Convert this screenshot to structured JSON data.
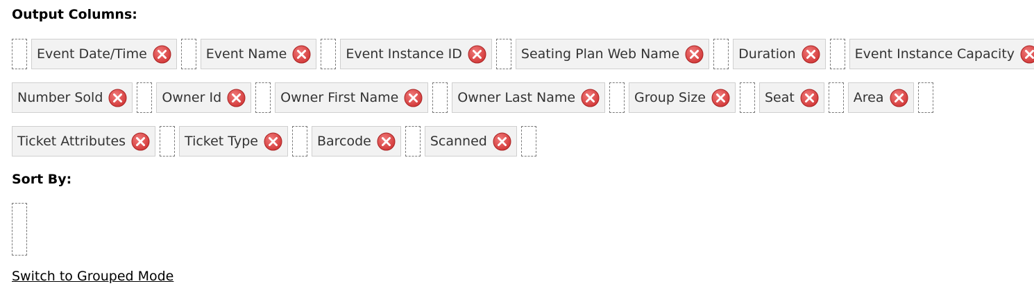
{
  "output_columns": {
    "heading": "Output Columns:",
    "rows": [
      [
        {
          "label": "Event Date/Time"
        },
        {
          "label": "Event Name"
        },
        {
          "label": "Event Instance ID"
        },
        {
          "label": "Seating Plan Web Name"
        },
        {
          "label": "Duration"
        },
        {
          "label": "Event Instance Capacity"
        }
      ],
      [
        {
          "label": "Number Sold"
        },
        {
          "label": "Owner Id"
        },
        {
          "label": "Owner First Name"
        },
        {
          "label": "Owner Last Name"
        },
        {
          "label": "Group Size"
        },
        {
          "label": "Seat"
        },
        {
          "label": "Area"
        }
      ],
      [
        {
          "label": "Ticket Attributes"
        },
        {
          "label": "Ticket Type"
        },
        {
          "label": "Barcode"
        },
        {
          "label": "Scanned"
        }
      ]
    ],
    "remove_icon": "remove-circle-icon"
  },
  "sort_by": {
    "heading": "Sort By:"
  },
  "switch_link": "Switch to Grouped Mode",
  "colors": {
    "remove_icon_red": "#d33a3a",
    "chip_background": "#f2f2f2",
    "chip_border": "#cfcfcf",
    "drop_slot_border": "#777777"
  }
}
